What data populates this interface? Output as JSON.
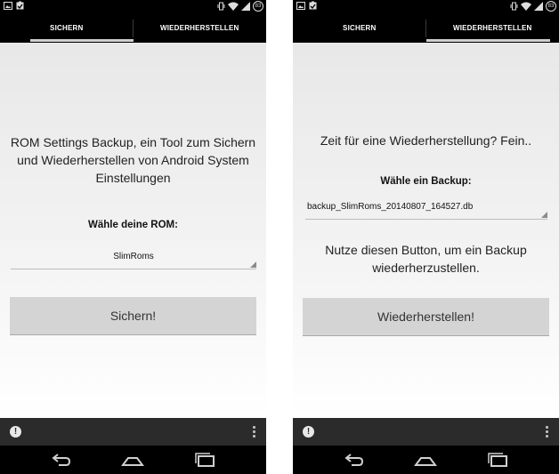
{
  "status_bar": {
    "battery_level": "83",
    "left_icons": [
      "image-icon",
      "clipboard-check-icon"
    ],
    "right_icons": [
      "vibrate-icon",
      "wifi-icon",
      "signal-icon",
      "battery-icon"
    ]
  },
  "left_screen": {
    "tabs": [
      {
        "label": "SICHERN",
        "selected": true
      },
      {
        "label": "WIEDERHERSTELLEN",
        "selected": false
      }
    ],
    "title": "ROM Settings Backup, ein Tool zum Sichern und Wiederherstellen von Android System Einstellungen",
    "rom_label": "Wähle deine ROM:",
    "rom_value": "SlimRoms",
    "action_button": "Sichern!"
  },
  "right_screen": {
    "tabs": [
      {
        "label": "SICHERN",
        "selected": false
      },
      {
        "label": "WIEDERHERSTELLEN",
        "selected": true
      }
    ],
    "title": "Zeit für eine Wiederherstellung? Fein..",
    "backup_label": "Wähle ein Backup:",
    "backup_value": "backup_SlimRoms_20140807_164527.db",
    "hint": "Nutze diesen Button, um ein Backup wiederherzustellen.",
    "action_button": "Wiederherstellen!"
  },
  "bottom_bar": {
    "alert_glyph": "!",
    "icons": [
      "alert-icon",
      "overflow-menu-icon"
    ]
  },
  "navigation": [
    "back-icon",
    "home-icon",
    "recents-icon"
  ],
  "colors": {
    "bars": "#000000",
    "tab_indicator": "#cfcfcf",
    "button": "#d4d4d4",
    "action_bar": "#2b2b2b"
  }
}
